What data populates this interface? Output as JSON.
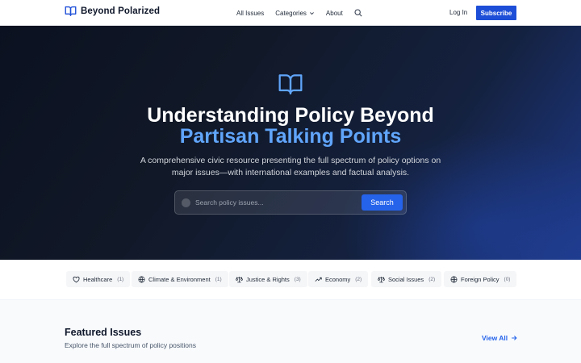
{
  "nav": {
    "brand": "Beyond Polarized",
    "links": [
      "All Issues",
      "Categories",
      "About"
    ],
    "login": "Log In",
    "subscribe": "Subscribe"
  },
  "hero": {
    "title_line1": "Understanding Policy Beyond",
    "title_line2": "Partisan Talking Points",
    "subtitle": "A comprehensive civic resource presenting the full spectrum of policy options on major issues—with international examples and factual analysis.",
    "search_placeholder": "Search policy issues...",
    "search_button": "Search"
  },
  "categories": [
    {
      "label": "Healthcare",
      "count": "(1)",
      "icon": "heart-icon"
    },
    {
      "label": "Climate & Environment",
      "count": "(1)",
      "icon": "globe-icon"
    },
    {
      "label": "Justice & Rights",
      "count": "(3)",
      "icon": "scale-icon"
    },
    {
      "label": "Economy",
      "count": "(2)",
      "icon": "trending-up-icon"
    },
    {
      "label": "Social Issues",
      "count": "(2)",
      "icon": "scale-icon"
    },
    {
      "label": "Foreign Policy",
      "count": "(0)",
      "icon": "globe-icon"
    }
  ],
  "featured": {
    "title": "Featured Issues",
    "subtitle": "Explore the full spectrum of policy positions",
    "view_all": "View All"
  },
  "colors": {
    "accent": "#1d4ed8",
    "highlight": "#60a5fa",
    "hero_dark": "#0b1120"
  }
}
